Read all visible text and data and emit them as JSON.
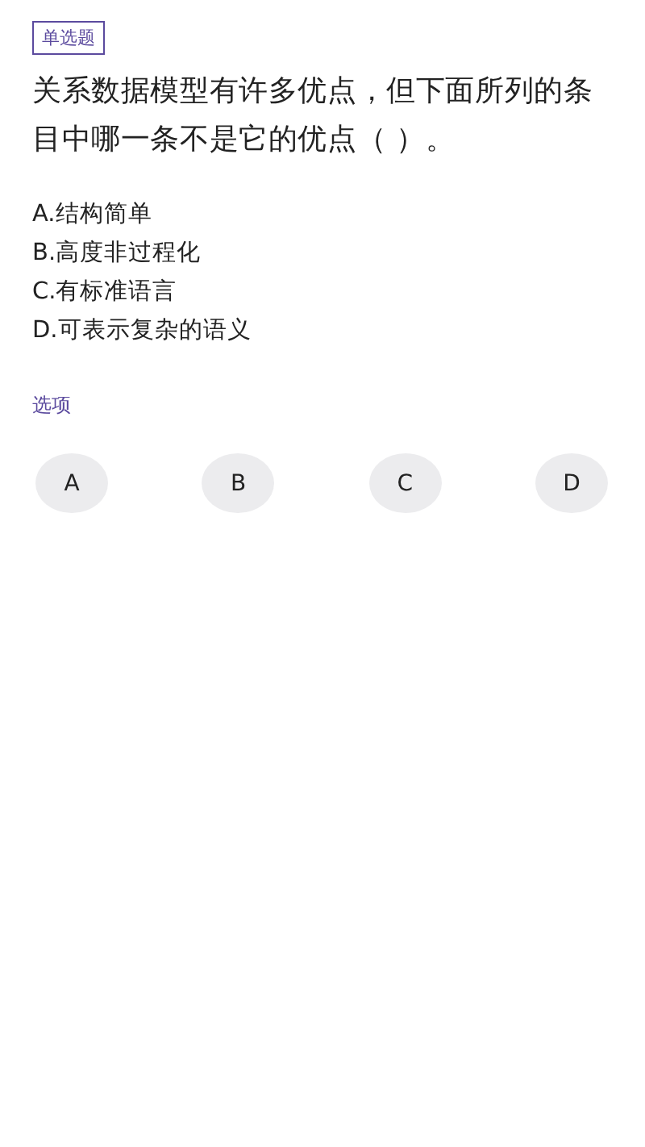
{
  "question_type": "单选题",
  "question": "关系数据模型有许多优点，但下面所列的条目中哪一条不是它的优点（ ）。",
  "options": [
    "A.结构简单",
    "B.高度非过程化",
    "C.有标准语言",
    "D.可表示复杂的语义"
  ],
  "choices_label": "选项",
  "choices": [
    {
      "label": "A",
      "selected": false
    },
    {
      "label": "B",
      "selected": false
    },
    {
      "label": "C",
      "selected": false
    },
    {
      "label": "D",
      "selected": false
    }
  ]
}
